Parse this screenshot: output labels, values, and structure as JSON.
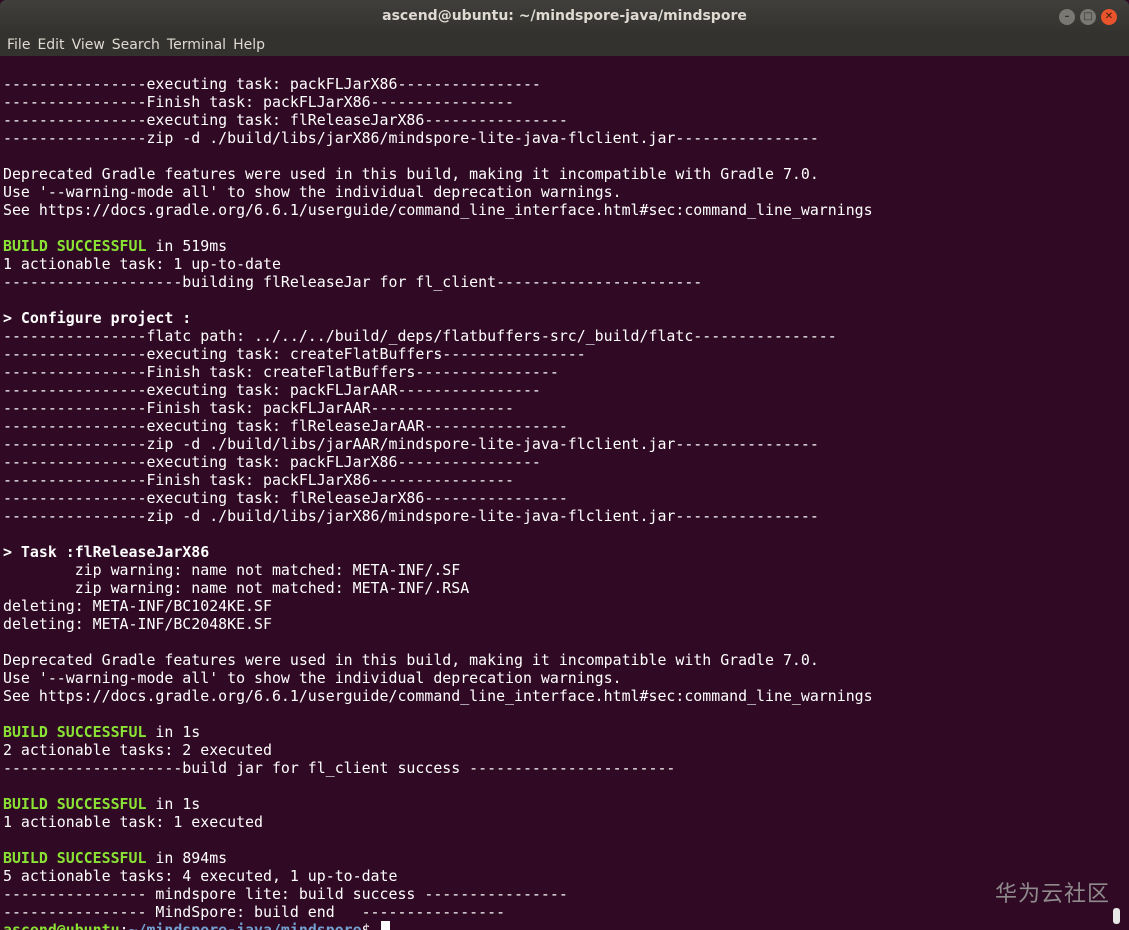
{
  "window": {
    "title": "ascend@ubuntu: ~/mindspore-java/mindspore",
    "buttons": {
      "minimize": "–",
      "maximize": "□",
      "close": "✕"
    }
  },
  "menubar": {
    "items": [
      "File",
      "Edit",
      "View",
      "Search",
      "Terminal",
      "Help"
    ]
  },
  "terminal": {
    "lines": [
      "----------------executing task: packFLJarX86----------------",
      "----------------Finish task: packFLJarX86----------------",
      "----------------executing task: flReleaseJarX86----------------",
      "----------------zip -d ./build/libs/jarX86/mindspore-lite-java-flclient.jar----------------",
      "",
      "Deprecated Gradle features were used in this build, making it incompatible with Gradle 7.0.",
      "Use '--warning-mode all' to show the individual deprecation warnings.",
      "See https://docs.gradle.org/6.6.1/userguide/command_line_interface.html#sec:command_line_warnings",
      "",
      "in 519ms",
      "1 actionable task: 1 up-to-date",
      "--------------------building flReleaseJar for fl_client-----------------------",
      "",
      "> Configure project :",
      "----------------flatc path: ../../../build/_deps/flatbuffers-src/_build/flatc----------------",
      "----------------executing task: createFlatBuffers----------------",
      "----------------Finish task: createFlatBuffers----------------",
      "----------------executing task: packFLJarAAR----------------",
      "----------------Finish task: packFLJarAAR----------------",
      "----------------executing task: flReleaseJarAAR----------------",
      "----------------zip -d ./build/libs/jarAAR/mindspore-lite-java-flclient.jar----------------",
      "----------------executing task: packFLJarX86----------------",
      "----------------Finish task: packFLJarX86----------------",
      "----------------executing task: flReleaseJarX86----------------",
      "----------------zip -d ./build/libs/jarX86/mindspore-lite-java-flclient.jar----------------",
      "",
      "> Task :flReleaseJarX86",
      "        zip warning: name not matched: META-INF/.SF",
      "        zip warning: name not matched: META-INF/.RSA",
      "deleting: META-INF/BC1024KE.SF",
      "deleting: META-INF/BC2048KE.SF",
      "",
      "Deprecated Gradle features were used in this build, making it incompatible with Gradle 7.0.",
      "Use '--warning-mode all' to show the individual deprecation warnings.",
      "See https://docs.gradle.org/6.6.1/userguide/command_line_interface.html#sec:command_line_warnings",
      "",
      "in 1s",
      "2 actionable tasks: 2 executed",
      "--------------------build jar for fl_client success -----------------------",
      "",
      "in 1s",
      "1 actionable task: 1 executed",
      "",
      "in 894ms",
      "5 actionable tasks: 4 executed, 1 up-to-date",
      "---------------- mindspore lite: build success ----------------",
      "---------------- MindSpore: build end   ----------------"
    ],
    "build_label": "BUILD SUCCESSFUL",
    "prompt": {
      "user_host": "ascend@ubuntu",
      "separator": ":",
      "path": "~/mindspore-java/mindspore",
      "symbol": "$ "
    }
  },
  "watermark": "华为云社区",
  "colors": {
    "background": "#300a24",
    "success": "#8ae234",
    "path": "#729fcf",
    "text": "#ffffff"
  }
}
